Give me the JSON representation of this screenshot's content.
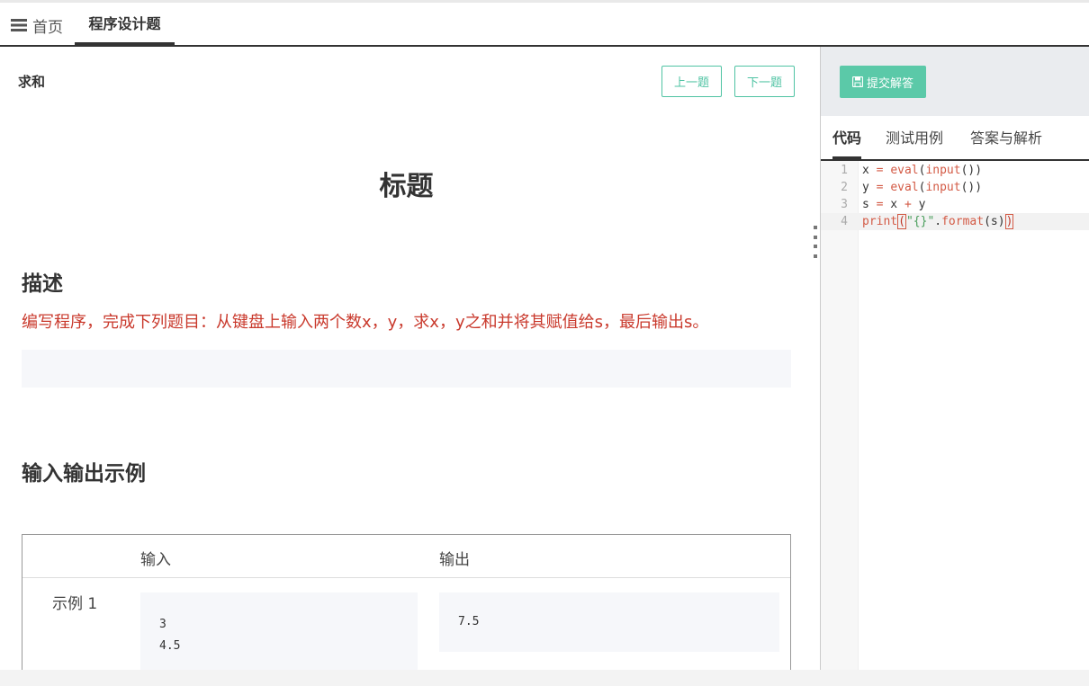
{
  "topbar": {
    "home_label": "首页",
    "active_tab_label": "程序设计题"
  },
  "problem": {
    "name": "求和",
    "prev_label": "上一题",
    "next_label": "下一题",
    "main_title": "标题",
    "description_heading": "描述",
    "description_text": "编写程序，完成下列题目：从键盘上输入两个数x，y，求x，y之和并将其赋值给s，最后输出s。",
    "io_heading": "输入输出示例",
    "io_table": {
      "input_header": "输入",
      "output_header": "输出",
      "rows": [
        {
          "label": "示例 1",
          "input_lines": [
            "3",
            "4.5"
          ],
          "output_lines": [
            "7.5"
          ]
        }
      ]
    }
  },
  "right_panel": {
    "submit_label": "提交解答",
    "tabs": [
      {
        "label": "代码",
        "active": true
      },
      {
        "label": "测试用例",
        "active": false
      },
      {
        "label": "答案与解析",
        "active": false
      }
    ],
    "code_lines": [
      {
        "num": "1",
        "text": "x = eval(input())"
      },
      {
        "num": "2",
        "text": "y = eval(input())"
      },
      {
        "num": "3",
        "text": "s = x + y"
      },
      {
        "num": "4",
        "text": "print(\"{}\".format(s))"
      }
    ],
    "current_line": 4
  },
  "colors": {
    "accent": "#4fc3a3",
    "submit_bg": "#5bc9a8",
    "description_text": "#c9392c"
  }
}
